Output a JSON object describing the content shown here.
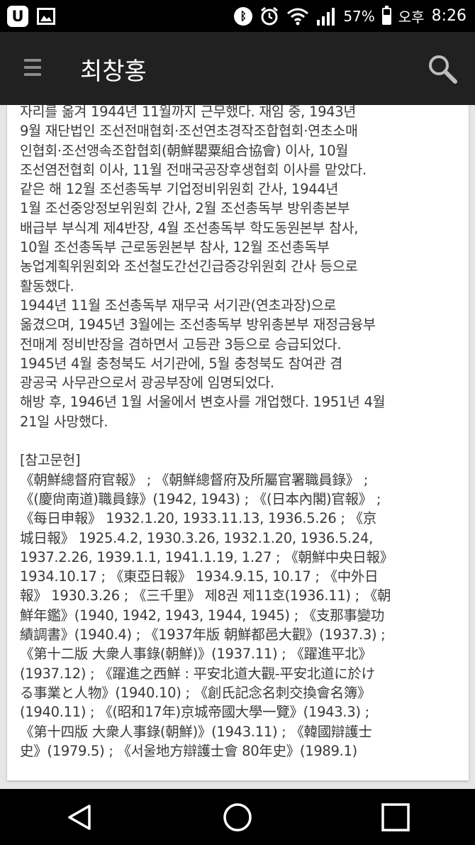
{
  "status_bar": {
    "battery_percent": "57%",
    "ampm": "오후",
    "time": "8:26",
    "battery_level": 0.57
  },
  "app_bar": {
    "title": "최창홍"
  },
  "article": {
    "lines": [
      "자리를 옮겨 1944년 11월까지 근무했다. 재임 중, 1943년",
      "9월 재단법인 조선전매협회·조선연초경작조합협회·연초소매",
      "인협회·조선앵속조합협회(朝鮮罌粟組合協會) 이사, 10월",
      "조선염전협회 이사, 11월 전매국공장후생협회 이사를 맡았다.",
      "같은 해 12월 조선총독부 기업정비위원회 간사, 1944년",
      "1월 조선중앙정보위원회 간사, 2월 조선총독부 방위총본부",
      "배급부 부식계 제4반장, 4월 조선총독부 학도동원본부 참사,",
      "10월 조선총독부 근로동원본부 참사, 12월 조선총독부",
      "농업계획위원회와 조선철도간선긴급증강위원회 간사 등으로",
      "활동했다.",
      "1944년 11월 조선총독부 재무국 서기관(연초과장)으로",
      "옮겼으며, 1945년 3월에는 조선총독부 방위총본부 재정금융부",
      "전매계 정비반장을 겸하면서 고등관 3등으로 승급되었다.",
      "1945년 4월 충청북도 서기관에, 5월 충청북도 참여관 겸",
      "광공국 사무관으로서 광공부장에 임명되었다.",
      "해방 후, 1946년 1월 서울에서 변호사를 개업했다. 1951년 4월",
      "21일 사망했다."
    ],
    "references_heading": "[참고문헌]",
    "references_lines": [
      "《朝鮮總督府官報》 ; 《朝鮮總督府及所屬官署職員錄》 ;",
      "《(慶尙南道)職員錄》(1942, 1943) ; 《(日本內閣)官報》 ;",
      "《每日申報》 1932.1.20, 1933.11.13, 1936.5.26 ; 《京",
      "城日報》 1925.4.2, 1930.3.26, 1932.1.20, 1936.5.24,",
      "1937.2.26, 1939.1.1, 1941.1.19, 1.27 ; 《朝鮮中央日報》",
      "1934.10.17 ; 《東亞日報》 1934.9.15, 10.17 ; 《中外日",
      "報》 1930.3.26 ; 《三千里》 제8권 제11호(1936.11) ; 《朝",
      "鮮年鑑》(1940, 1942, 1943, 1944, 1945) ; 《支那事變功",
      "績調書》(1940.4) ; 《1937年版 朝鮮都邑大觀》(1937.3) ;",
      "《第十二版 大衆人事錄(朝鮮)》(1937.11) ; 《躍進平北》",
      "(1937.12) ; 《躍進之西鮮 : 平安北道大觀-平安北道に於け",
      "る事業と人物》(1940.10) ; 《創氏記念名刺交換會名簿》",
      "(1940.11) ; 《(昭和17年)京城帝國大學一覽》(1943.3) ;",
      "《第十四版 大衆人事錄(朝鮮)》(1943.11) ; 《韓國辯護士",
      "史》(1979.5) ; 《서울地方辯護士會 80年史》(1989.1)"
    ]
  },
  "icons": {
    "status_left": [
      "u-plus-icon",
      "image-icon"
    ],
    "status_right": [
      "bluetooth-icon",
      "alarm-icon",
      "wifi-icon",
      "signal-icon",
      "battery-icon"
    ],
    "app_bar": [
      "menu-icon",
      "search-icon"
    ],
    "nav": [
      "back-icon",
      "home-icon",
      "recents-icon"
    ]
  },
  "colors": {
    "app_bar": "#212121",
    "status_bar": "#000000",
    "page_background": "#e6e6e6",
    "card": "#ffffff",
    "text": "#3a3a3a"
  }
}
